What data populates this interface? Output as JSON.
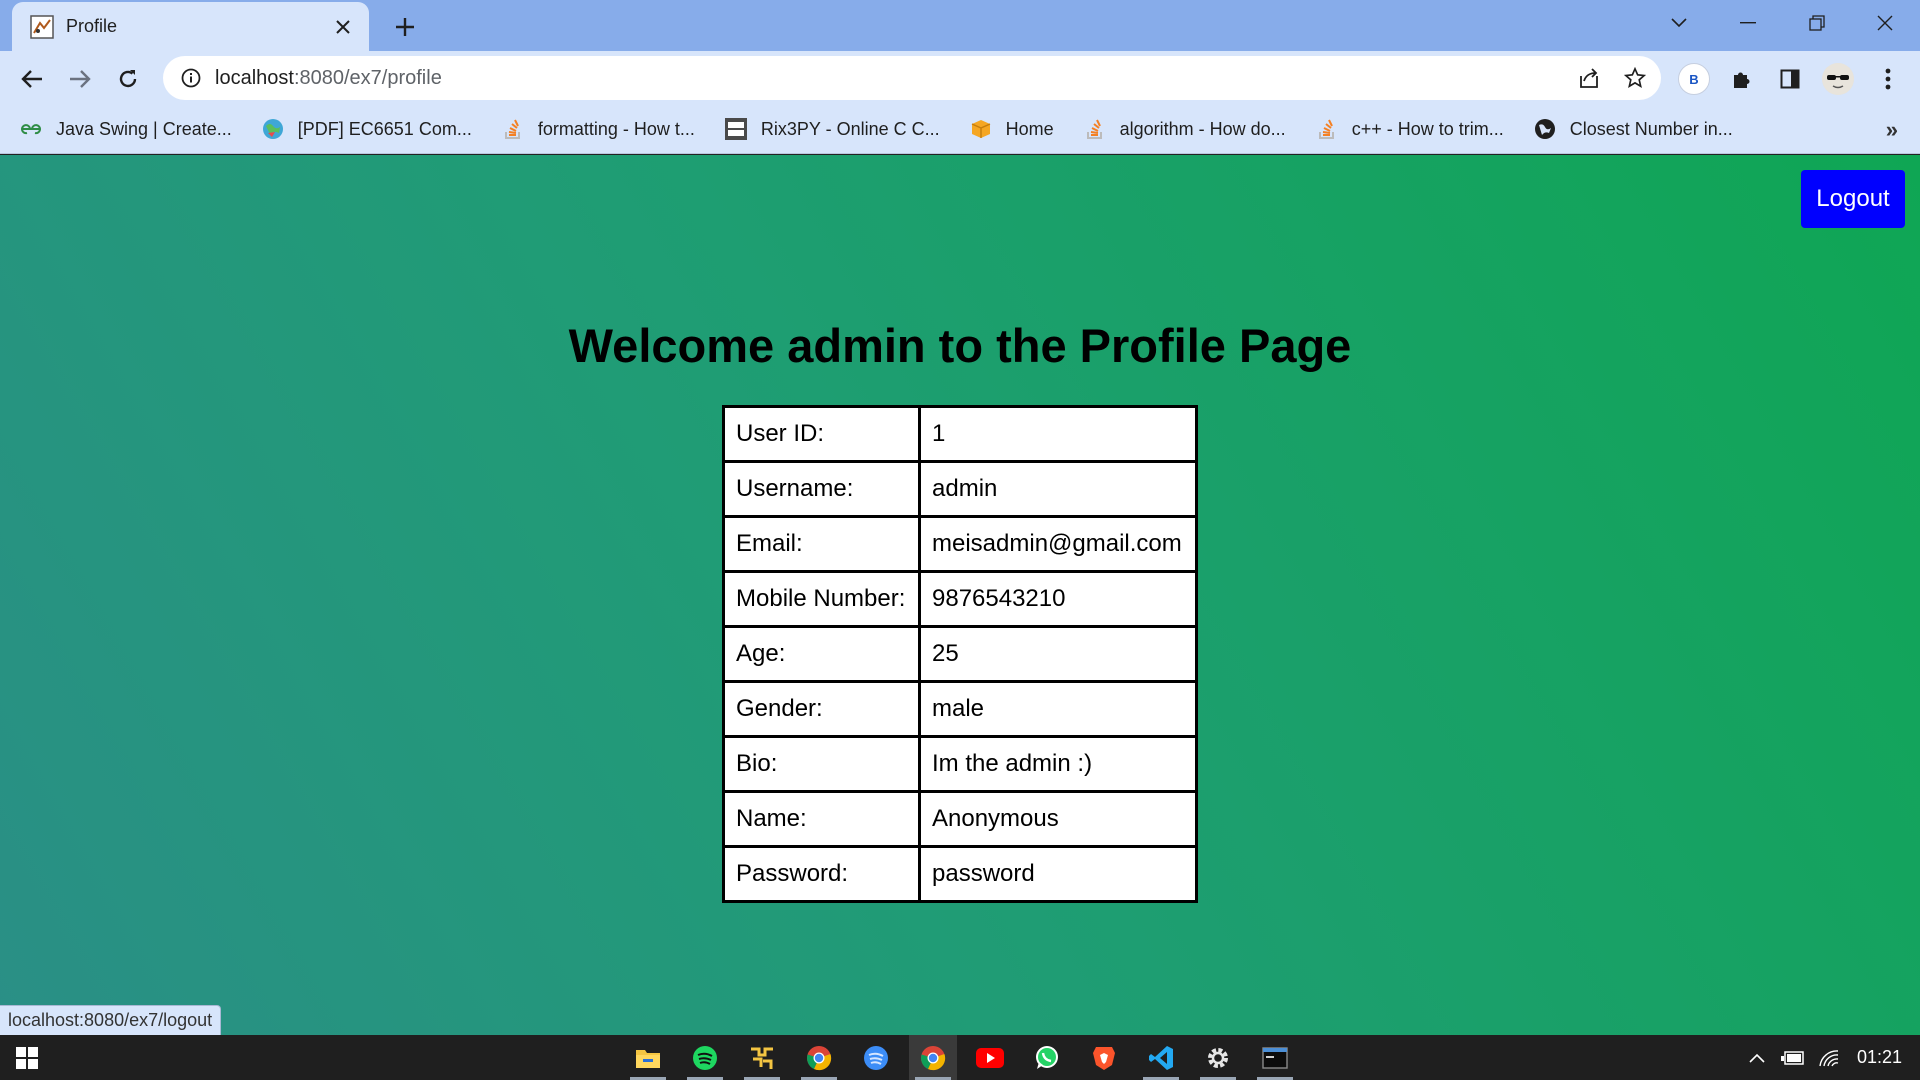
{
  "browser": {
    "tab_title": "Profile",
    "url_host": "localhost",
    "url_path": ":8080/ex7/profile",
    "profile_badge": "B",
    "bookmarks": [
      {
        "label": "Java Swing | Create...",
        "icon": "geeksforgeeks-icon"
      },
      {
        "label": "[PDF] EC6651 Com...",
        "icon": "globe-colorful-icon"
      },
      {
        "label": "formatting - How t...",
        "icon": "stackoverflow-icon"
      },
      {
        "label": "Rix3PY - Online C C...",
        "icon": "ideone-icon"
      },
      {
        "label": "Home",
        "icon": "box-icon"
      },
      {
        "label": "algorithm - How do...",
        "icon": "stackoverflow-icon"
      },
      {
        "label": "c++ - How to trim...",
        "icon": "stackoverflow-icon"
      },
      {
        "label": "Closest Number in...",
        "icon": "globe-icon"
      }
    ],
    "bookmarks_more": "»",
    "status_url": "localhost:8080/ex7/logout"
  },
  "page": {
    "logout_label": "Logout",
    "heading": "Welcome admin to the Profile Page",
    "profile_rows": [
      {
        "label": "User ID:",
        "value": "1"
      },
      {
        "label": "Username:",
        "value": "admin"
      },
      {
        "label": "Email:",
        "value": "meisadmin@gmail.com"
      },
      {
        "label": "Mobile Number:",
        "value": "9876543210"
      },
      {
        "label": "Age:",
        "value": "25"
      },
      {
        "label": "Gender:",
        "value": "male"
      },
      {
        "label": "Bio:",
        "value": "Im the admin :)"
      },
      {
        "label": "Name:",
        "value": "Anonymous"
      },
      {
        "label": "Password:",
        "value": "password"
      }
    ]
  },
  "taskbar": {
    "clock": "01:21"
  },
  "colors": {
    "logout_button": "#0000ff",
    "page_gradient_start": "#2a8f86",
    "page_gradient_end": "#0fa654"
  }
}
